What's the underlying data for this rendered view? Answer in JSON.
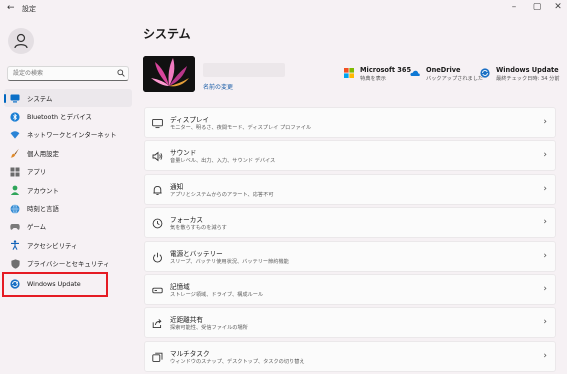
{
  "window": {
    "title": "設定",
    "back_glyph": "←",
    "min_glyph": "–",
    "max_glyph": "▢",
    "close_glyph": "✕"
  },
  "search": {
    "placeholder": "設定の検索"
  },
  "sidebar": {
    "items": [
      {
        "label": "システム",
        "icon": "system-monitor-icon",
        "active": true
      },
      {
        "label": "Bluetooth とデバイス",
        "icon": "bluetooth-icon"
      },
      {
        "label": "ネットワークとインターネット",
        "icon": "wifi-icon"
      },
      {
        "label": "個人用設定",
        "icon": "paintbrush-icon"
      },
      {
        "label": "アプリ",
        "icon": "apps-icon"
      },
      {
        "label": "アカウント",
        "icon": "account-icon"
      },
      {
        "label": "時刻と言語",
        "icon": "globe-clock-icon"
      },
      {
        "label": "ゲーム",
        "icon": "game-controller-icon"
      },
      {
        "label": "アクセシビリティ",
        "icon": "accessibility-icon"
      },
      {
        "label": "プライバシーとセキュリティ",
        "icon": "shield-icon"
      },
      {
        "label": "Windows Update",
        "icon": "windows-update-icon"
      }
    ]
  },
  "main": {
    "title": "システム",
    "rename_label": "名前の変更",
    "tiles": [
      {
        "name": "Microsoft 365",
        "sub": "特典を表示",
        "icon": "microsoft365-icon"
      },
      {
        "name": "OneDrive",
        "sub": "バックアップされました",
        "icon": "onedrive-icon"
      },
      {
        "name": "Windows Update",
        "sub": "最終チェック日時: 34 分前",
        "icon": "windows-update-icon"
      }
    ],
    "cards": [
      {
        "title": "ディスプレイ",
        "sub": "モニター、明るさ、夜間モード、ディスプレイ プロファイル",
        "icon": "display-icon"
      },
      {
        "title": "サウンド",
        "sub": "音量レベル、出力、入力、サウンド デバイス",
        "icon": "sound-icon"
      },
      {
        "title": "通知",
        "sub": "アプリとシステムからのアラート、応答不可",
        "icon": "bell-icon"
      },
      {
        "title": "フォーカス",
        "sub": "気を散らすものを減らす",
        "icon": "focus-icon"
      },
      {
        "title": "電源とバッテリー",
        "sub": "スリープ、バッテリ使用状況、バッテリー節約機能",
        "icon": "power-icon"
      },
      {
        "title": "記憶域",
        "sub": "ストレージ領域、ドライブ、構成ルール",
        "icon": "storage-icon"
      },
      {
        "title": "近距離共有",
        "sub": "探索可能性、受信ファイルの場所",
        "icon": "share-icon"
      },
      {
        "title": "マルチタスク",
        "sub": "ウィンドウのスナップ、デスクトップ、タスクの切り替え",
        "icon": "multitask-icon"
      }
    ]
  },
  "colors": {
    "accent": "#0067c0",
    "highlight_box": "#e51b23",
    "background": "#f6f1f4"
  }
}
